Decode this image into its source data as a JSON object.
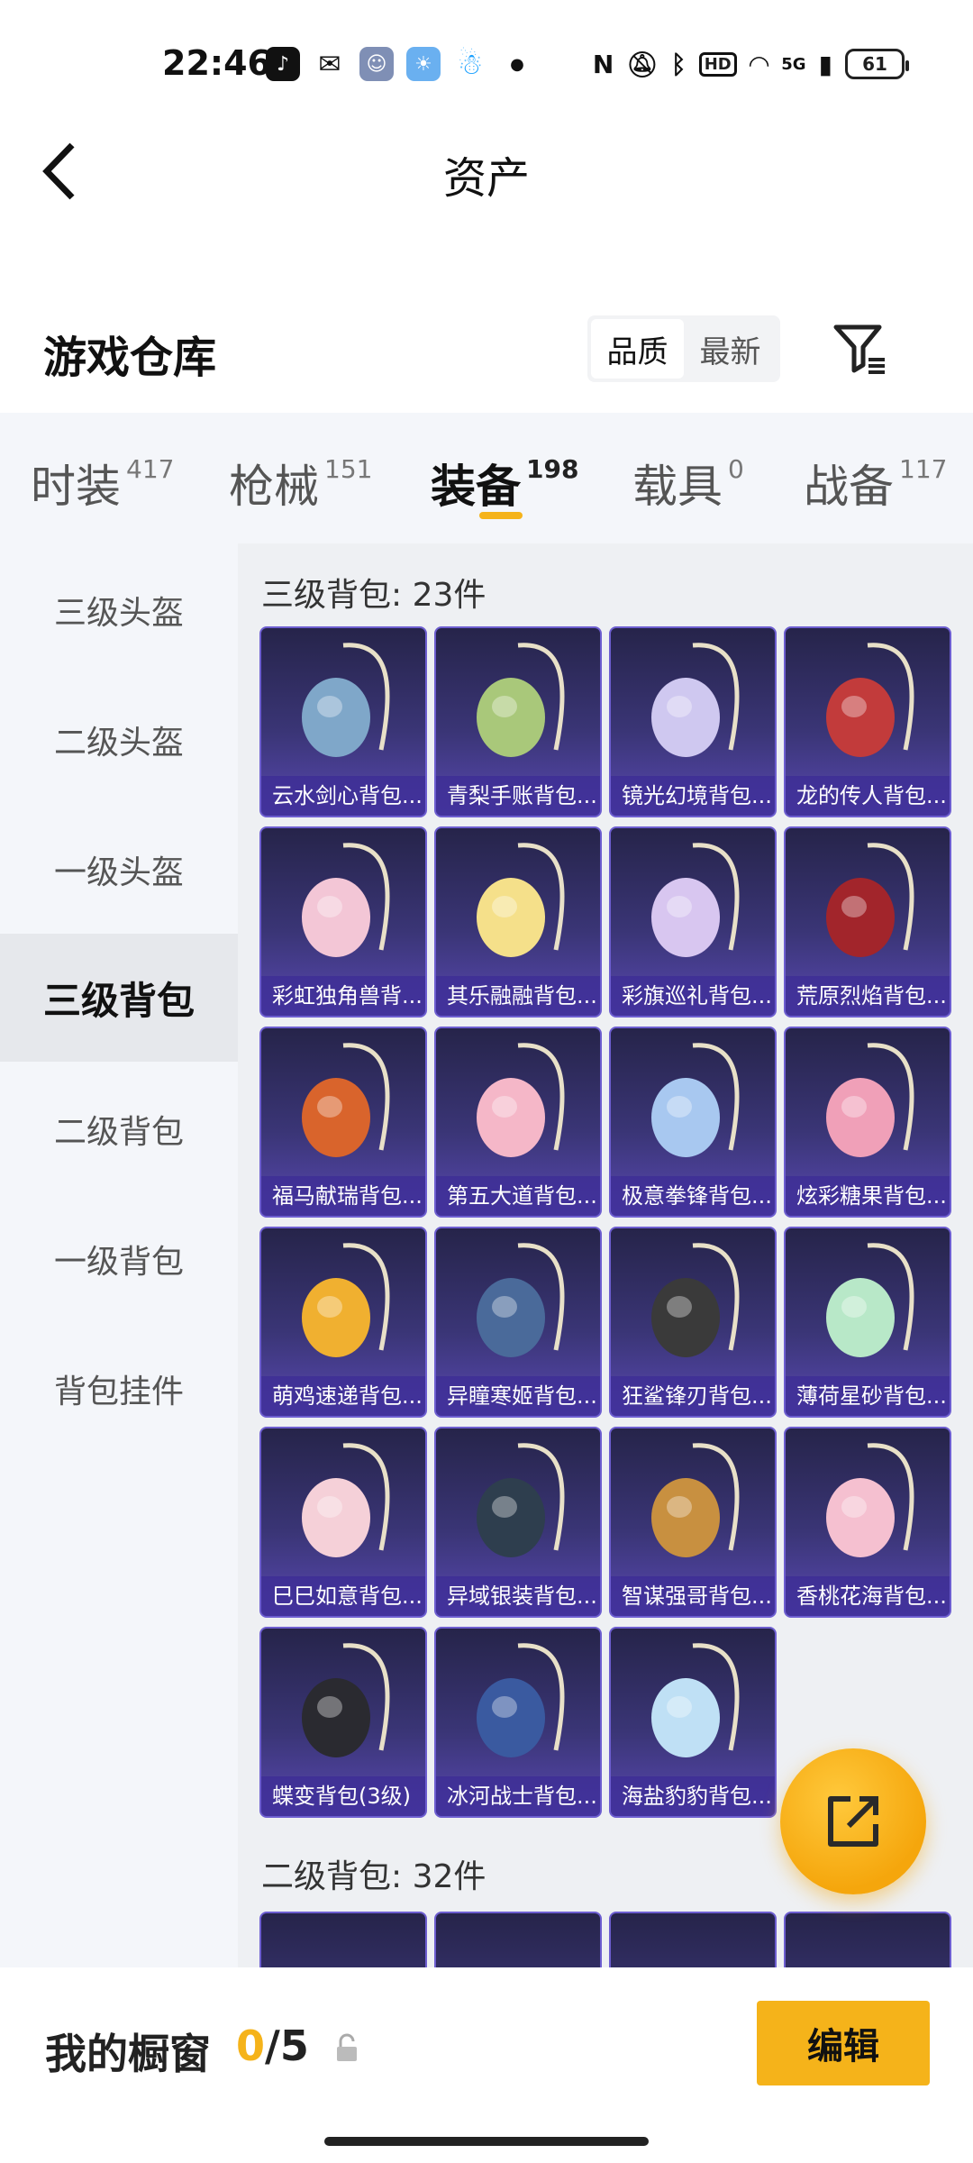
{
  "status_bar": {
    "time": "22:46",
    "network": "5G",
    "hd": "HD",
    "battery": "61"
  },
  "header": {
    "title": "资产"
  },
  "warehouse": {
    "title": "游戏仓库",
    "sort_options": [
      "品质",
      "最新"
    ],
    "active_sort": "品质"
  },
  "tabs": [
    {
      "label": "时装",
      "count": "417"
    },
    {
      "label": "枪械",
      "count": "151"
    },
    {
      "label": "装备",
      "count": "198"
    },
    {
      "label": "载具",
      "count": "0"
    },
    {
      "label": "战备",
      "count": "117"
    }
  ],
  "sidebar": {
    "items": [
      {
        "label": "三级头盔"
      },
      {
        "label": "二级头盔"
      },
      {
        "label": "一级头盔"
      },
      {
        "label": "三级背包"
      },
      {
        "label": "二级背包"
      },
      {
        "label": "一级背包"
      },
      {
        "label": "背包挂件"
      }
    ]
  },
  "sections": [
    {
      "title": "三级背包: 23件",
      "items": [
        {
          "name": "云水剑心背包...",
          "color": "#7fa7c9"
        },
        {
          "name": "青梨手账背包...",
          "color": "#a9c87a"
        },
        {
          "name": "镜光幻境背包...",
          "color": "#cfc8f0"
        },
        {
          "name": "龙的传人背包...",
          "color": "#c23b3b"
        },
        {
          "name": "彩虹独角兽背...",
          "color": "#f3c6d6"
        },
        {
          "name": "其乐融融背包...",
          "color": "#f5e08a"
        },
        {
          "name": "彩旗巡礼背包...",
          "color": "#d8c6f0"
        },
        {
          "name": "荒原烈焰背包...",
          "color": "#a2252b"
        },
        {
          "name": "福马献瑞背包...",
          "color": "#d9642c"
        },
        {
          "name": "第五大道背包...",
          "color": "#f5b7c8"
        },
        {
          "name": "极意拳锋背包...",
          "color": "#a8c8f0"
        },
        {
          "name": "炫彩糖果背包...",
          "color": "#f0a0b8"
        },
        {
          "name": "萌鸡速递背包...",
          "color": "#f0b030"
        },
        {
          "name": "异瞳寒姬背包...",
          "color": "#4a6a9a"
        },
        {
          "name": "狂鲨锋刃背包...",
          "color": "#3a3a3a"
        },
        {
          "name": "薄荷星砂背包...",
          "color": "#b8e8c8"
        },
        {
          "name": "巳巳如意背包...",
          "color": "#f5d0d8"
        },
        {
          "name": "异域银装背包...",
          "color": "#2e3e4e"
        },
        {
          "name": "智谋强哥背包...",
          "color": "#c89040"
        },
        {
          "name": "香桃花海背包...",
          "color": "#f5c0d0"
        },
        {
          "name": "蝶变背包(3级)",
          "color": "#2a2a30"
        },
        {
          "name": "冰河战士背包...",
          "color": "#3a5aa0"
        },
        {
          "name": "海盐豹豹背包...",
          "color": "#bfe0f5"
        }
      ]
    },
    {
      "title": "二级背包: 32件"
    }
  ],
  "bottom": {
    "showcase_label": "我的橱窗",
    "showcase_current": "0",
    "showcase_total": "/5",
    "edit_label": "编辑"
  },
  "colors": {
    "accent": "#f5b31a",
    "card_bottom": "#5848b0"
  },
  "icons": [
    "back-arrow-icon",
    "filter-icon",
    "share-out-icon",
    "lock-icon"
  ]
}
